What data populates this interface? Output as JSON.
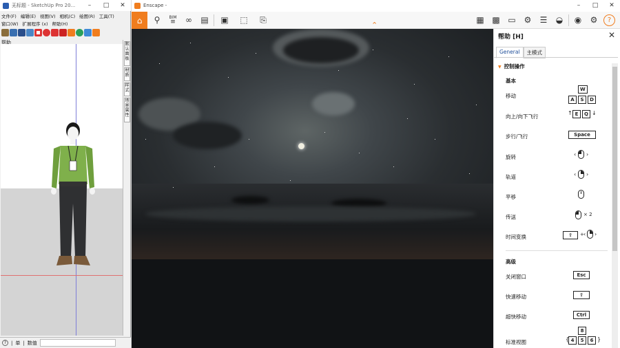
{
  "sketchup": {
    "title": "无标题 - SketchUp Pro 20...",
    "menu_row1": [
      "文件(F)",
      "编辑(E)",
      "视图(V)",
      "相机(C)",
      "绘图(R)",
      "工具(T)"
    ],
    "menu_row2": [
      "窗口(W)",
      "扩展程序 (x)",
      "帮助(H)"
    ],
    "tray_label": "帮助",
    "side_tabs": [
      "默认面板",
      "材质",
      "样式",
      "场景属性"
    ],
    "status": {
      "help_icon": "?",
      "unit": "单",
      "measure_label": "数值"
    }
  },
  "enscape": {
    "title": "Enscape -",
    "toolbar_left": [
      "home-icon",
      "pin-icon",
      "bim-icon",
      "binoculars-icon",
      "clapper-icon",
      "screenshot-icon",
      "panorama-icon",
      "export-icon"
    ],
    "bim_label": "BIM",
    "toolbar_right": [
      "map-icon",
      "asset-library-icon",
      "gallery-icon",
      "visual-settings-icon",
      "settings-icon",
      "vr-icon",
      "eye-icon",
      "gear-icon",
      "help-icon"
    ],
    "help_panel": {
      "title": "帮助 [H]",
      "tabs": [
        "General",
        "主模式"
      ],
      "section": "控制操作",
      "basic_heading": "基本",
      "basic_rows": [
        {
          "label": "移动",
          "keys": [
            "W",
            "A",
            "S",
            "D"
          ]
        },
        {
          "label": "向上/向下飞行",
          "keys": [
            "E",
            "Q"
          ]
        },
        {
          "label": "步行/飞行",
          "keys": [
            "Space"
          ]
        },
        {
          "label": "旋转"
        },
        {
          "label": "轨道"
        },
        {
          "label": "平移"
        },
        {
          "label": "传送",
          "suffix": "× 2"
        },
        {
          "label": "时间变换",
          "plus": "+"
        }
      ],
      "advanced_heading": "高级",
      "advanced_rows": [
        {
          "label": "关闭窗口",
          "keys": [
            "Esc"
          ]
        },
        {
          "label": "快速移动"
        },
        {
          "label": "超快移动",
          "keys": [
            "Ctrl"
          ]
        },
        {
          "label": "标准视图",
          "keys": [
            "8",
            "4",
            "5",
            "6"
          ]
        }
      ]
    }
  },
  "colors": {
    "accent": "#f07d1e",
    "sky": "#40464a",
    "tab_active": "#1f4e99"
  }
}
